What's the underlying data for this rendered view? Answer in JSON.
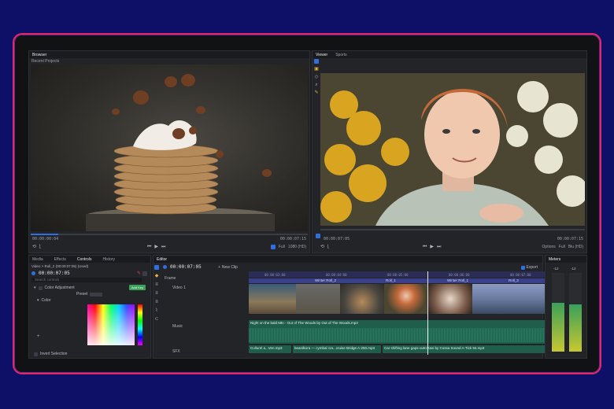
{
  "colors": {
    "background": "#0e0f66",
    "frame_border": "#e0286a",
    "accent": "#2f6fe0",
    "audio_track": "#1f5e4a",
    "video_track": "#3a3f8a"
  },
  "source_viewer": {
    "tabs": [
      "Browser"
    ],
    "subtab": "Recent Projects",
    "timecode_left": "00:00:00:04",
    "timecode_right": "00:00:07:15",
    "zoom": "Full",
    "resolution": "1080 (HD)"
  },
  "program_viewer": {
    "tabs": [
      "Viewer",
      "Sports"
    ],
    "timecode_left": "00:00:07:05",
    "timecode_right": "00:00:07:15",
    "options": "Options",
    "zoom": "Full",
    "resolution": "Blu (HD)"
  },
  "controls_panel": {
    "tabs": [
      "Media",
      "Effects",
      "Controls",
      "History"
    ],
    "path": "Video > Roll_2 (00:00:07:05) (Used)",
    "timecode": "00:00:07:05",
    "search_placeholder": "Search controls",
    "effect_name": "Color Adjustment",
    "preset_label": "Preset",
    "add_label": "Add Key",
    "color_label": "Color",
    "bottom_label": "Invert Selection"
  },
  "timeline": {
    "tab": "Editor",
    "timecode": "00:00:07:05",
    "new_clip": "New Clip",
    "export_label": "Export",
    "tracks": [
      "Frame",
      "Video 1",
      "Music",
      "SFX"
    ],
    "markers": [
      "Winter Roll_2",
      "Roll_1",
      "Winter Roll_1",
      "Roll_3"
    ],
    "ruler": [
      "00:00:03:00",
      "00:00:04:00",
      "00:00:05:00",
      "00:00:06:00",
      "00:00:07:00",
      "00:00:08:00"
    ],
    "music_clip": "Night on the bald Mtn - Out of The Woods by Out of The Woods.mp3",
    "sfx_clips": [
      "Cullurel a...Ven.mp3",
      "beardkora — cymbal cra...cruise Bridge A-250.mp3",
      "Car shifting lane gaps-outcr taxi by Cossa Sound A-Tick 94.mp3"
    ]
  },
  "meters": {
    "tab": "Meters",
    "left_label": "-12",
    "right_label": "-12",
    "left_level": 0.62,
    "right_level": 0.6
  }
}
